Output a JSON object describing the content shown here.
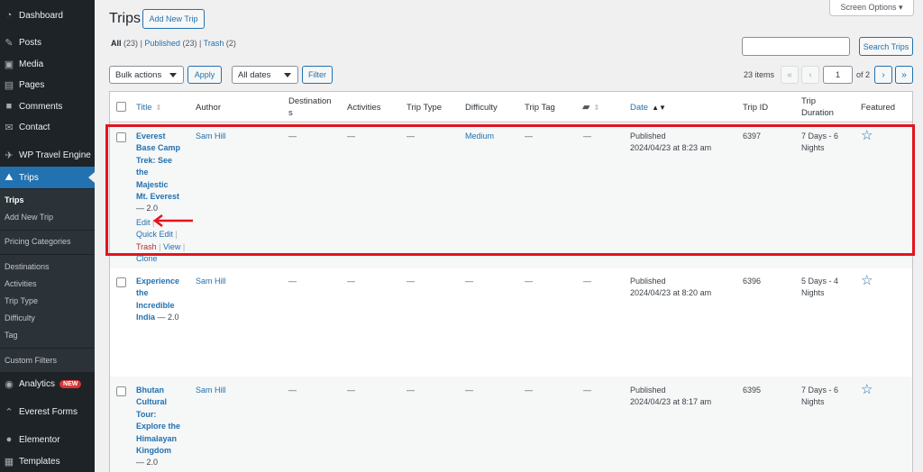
{
  "sidebar": {
    "items": [
      {
        "label": "Dashboard",
        "icon": "dashboard-icon"
      },
      {
        "label": "Posts",
        "icon": "pin-icon"
      },
      {
        "label": "Media",
        "icon": "media-icon"
      },
      {
        "label": "Pages",
        "icon": "pages-icon"
      },
      {
        "label": "Comments",
        "icon": "comment-icon"
      },
      {
        "label": "Contact",
        "icon": "mail-icon"
      },
      {
        "label": "WP Travel Engine",
        "icon": "travel-icon"
      },
      {
        "label": "Trips",
        "icon": "hikers-icon"
      },
      {
        "label": "Analytics",
        "icon": "analytics-icon",
        "badge": "NEW"
      },
      {
        "label": "Everest Forms",
        "icon": "forms-icon"
      },
      {
        "label": "Elementor",
        "icon": "elementor-icon"
      },
      {
        "label": "Templates",
        "icon": "templates-icon"
      }
    ],
    "submenu": [
      "Trips",
      "Add New Trip",
      "Pricing Categories",
      "Destinations",
      "Activities",
      "Trip Type",
      "Difficulty",
      "Tag",
      "Custom Filters"
    ]
  },
  "header": {
    "title": "Trips",
    "add_new": "Add New Trip",
    "screen_options": "Screen Options ▾"
  },
  "views": {
    "all": "All",
    "all_count": "(23)",
    "published": "Published",
    "published_count": "(23)",
    "trash": "Trash",
    "trash_count": "(2)"
  },
  "search": {
    "button": "Search Trips",
    "value": ""
  },
  "filters": {
    "bulk_actions": "Bulk actions",
    "apply": "Apply",
    "dates": "All dates",
    "filter": "Filter"
  },
  "pagination": {
    "items": "23 items",
    "first": "«",
    "prev": "‹",
    "current": "1",
    "of": "of 2",
    "next": "›",
    "last": "»"
  },
  "columns": {
    "title": "Title",
    "author": "Author",
    "destinations_1": "Destination",
    "destinations_2": "s",
    "activities": "Activities",
    "trip_type": "Trip Type",
    "difficulty": "Difficulty",
    "trip_tag": "Trip Tag",
    "date": "Date",
    "trip_id": "Trip ID",
    "duration_1": "Trip",
    "duration_2": "Duration",
    "featured": "Featured"
  },
  "rows": [
    {
      "title_lines": [
        "Everest",
        "Base Camp",
        "Trek: See",
        "the",
        "Majestic",
        "Mt. Everest"
      ],
      "suffix": "— 2.0",
      "author": "Sam Hill",
      "destinations": "—",
      "activities": "—",
      "trip_type": "—",
      "difficulty": "Medium",
      "trip_tag": "—",
      "comments": "—",
      "status": "Published",
      "datetime": "2024/04/23 at 8:23 am",
      "trip_id": "6397",
      "duration_1": "7 Days - 6",
      "duration_2": "Nights",
      "actions": {
        "edit": "Edit",
        "quick_edit": "Quick Edit",
        "trash": "Trash",
        "view": "View",
        "clone": "Clone"
      }
    },
    {
      "title_lines": [
        "Experience",
        "the",
        "Incredible"
      ],
      "title_last": "India",
      "suffix": "— 2.0",
      "author": "Sam Hill",
      "destinations": "—",
      "activities": "—",
      "trip_type": "—",
      "difficulty": "—",
      "trip_tag": "—",
      "comments": "—",
      "status": "Published",
      "datetime": "2024/04/23 at 8:20 am",
      "trip_id": "6396",
      "duration_1": "5 Days - 4",
      "duration_2": "Nights"
    },
    {
      "title_lines": [
        "Bhutan",
        "Cultural",
        "Tour:",
        "Explore the",
        "Himalayan",
        "Kingdom"
      ],
      "suffix": "— 2.0",
      "author": "Sam Hill",
      "destinations": "—",
      "activities": "—",
      "trip_type": "—",
      "difficulty": "—",
      "trip_tag": "—",
      "comments": "—",
      "status": "Published",
      "datetime": "2024/04/23 at 8:17 am",
      "trip_id": "6395",
      "duration_1": "7 Days - 6",
      "duration_2": "Nights"
    }
  ],
  "colors": {
    "accent": "#2271b1",
    "sidebar": "#1d2327",
    "highlight": "#e3141d",
    "trash": "#b32d2e"
  }
}
